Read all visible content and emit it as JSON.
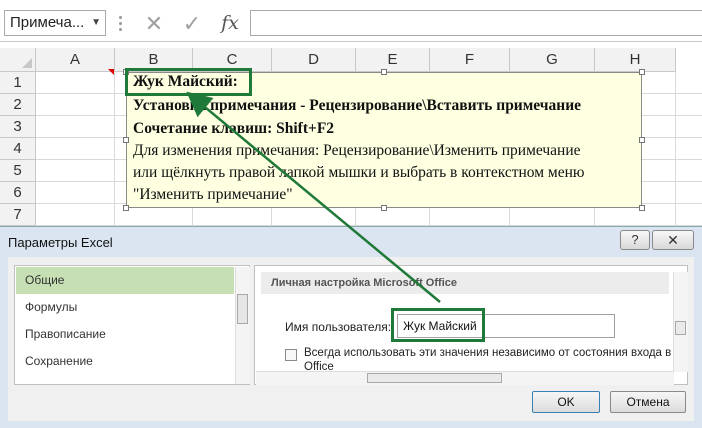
{
  "formula_bar": {
    "name_box": "Примеча...",
    "cancel_icon": "✕",
    "enter_icon": "✓",
    "fx_icon": "fx",
    "formula_value": ""
  },
  "sheet": {
    "columns": [
      "A",
      "B",
      "C",
      "D",
      "E",
      "F",
      "G",
      "H"
    ],
    "rows": [
      "1",
      "2",
      "3",
      "4",
      "5",
      "6",
      "7"
    ]
  },
  "comment": {
    "author": "Жук Майский:",
    "line_bold_1": "Установка примечания - Рецензирование\\Вставить примечание",
    "line_bold_2": "Сочетание клавиш: Shift+F2",
    "line_3": "Для изменения примечания: Рецензирование\\Изменить примечание",
    "line_4": "или щёлкнуть правой лапкой мышки и выбрать в контекстном меню",
    "line_5": "\"Изменить примечание\""
  },
  "dialog": {
    "title": "Параметры Excel",
    "help_label": "?",
    "close_label": "✕",
    "nav": [
      {
        "label": "Общие",
        "selected": true
      },
      {
        "label": "Формулы",
        "selected": false
      },
      {
        "label": "Правописание",
        "selected": false
      },
      {
        "label": "Сохранение",
        "selected": false
      }
    ],
    "section_header": "Личная настройка Microsoft Office",
    "user_label": "Имя пользователя:",
    "user_value": "Жук Майский",
    "always_label": "Всегда использовать эти значения независимо от состояния входа в Office",
    "always_checked": false,
    "ok_label": "OK",
    "cancel_label": "Отмена"
  },
  "colors": {
    "highlight": "#1f7a3a",
    "comment_bg": "#ffffe1",
    "nav_selected": "#c6e0b4",
    "dialog_bg": "#dbe5f1"
  }
}
